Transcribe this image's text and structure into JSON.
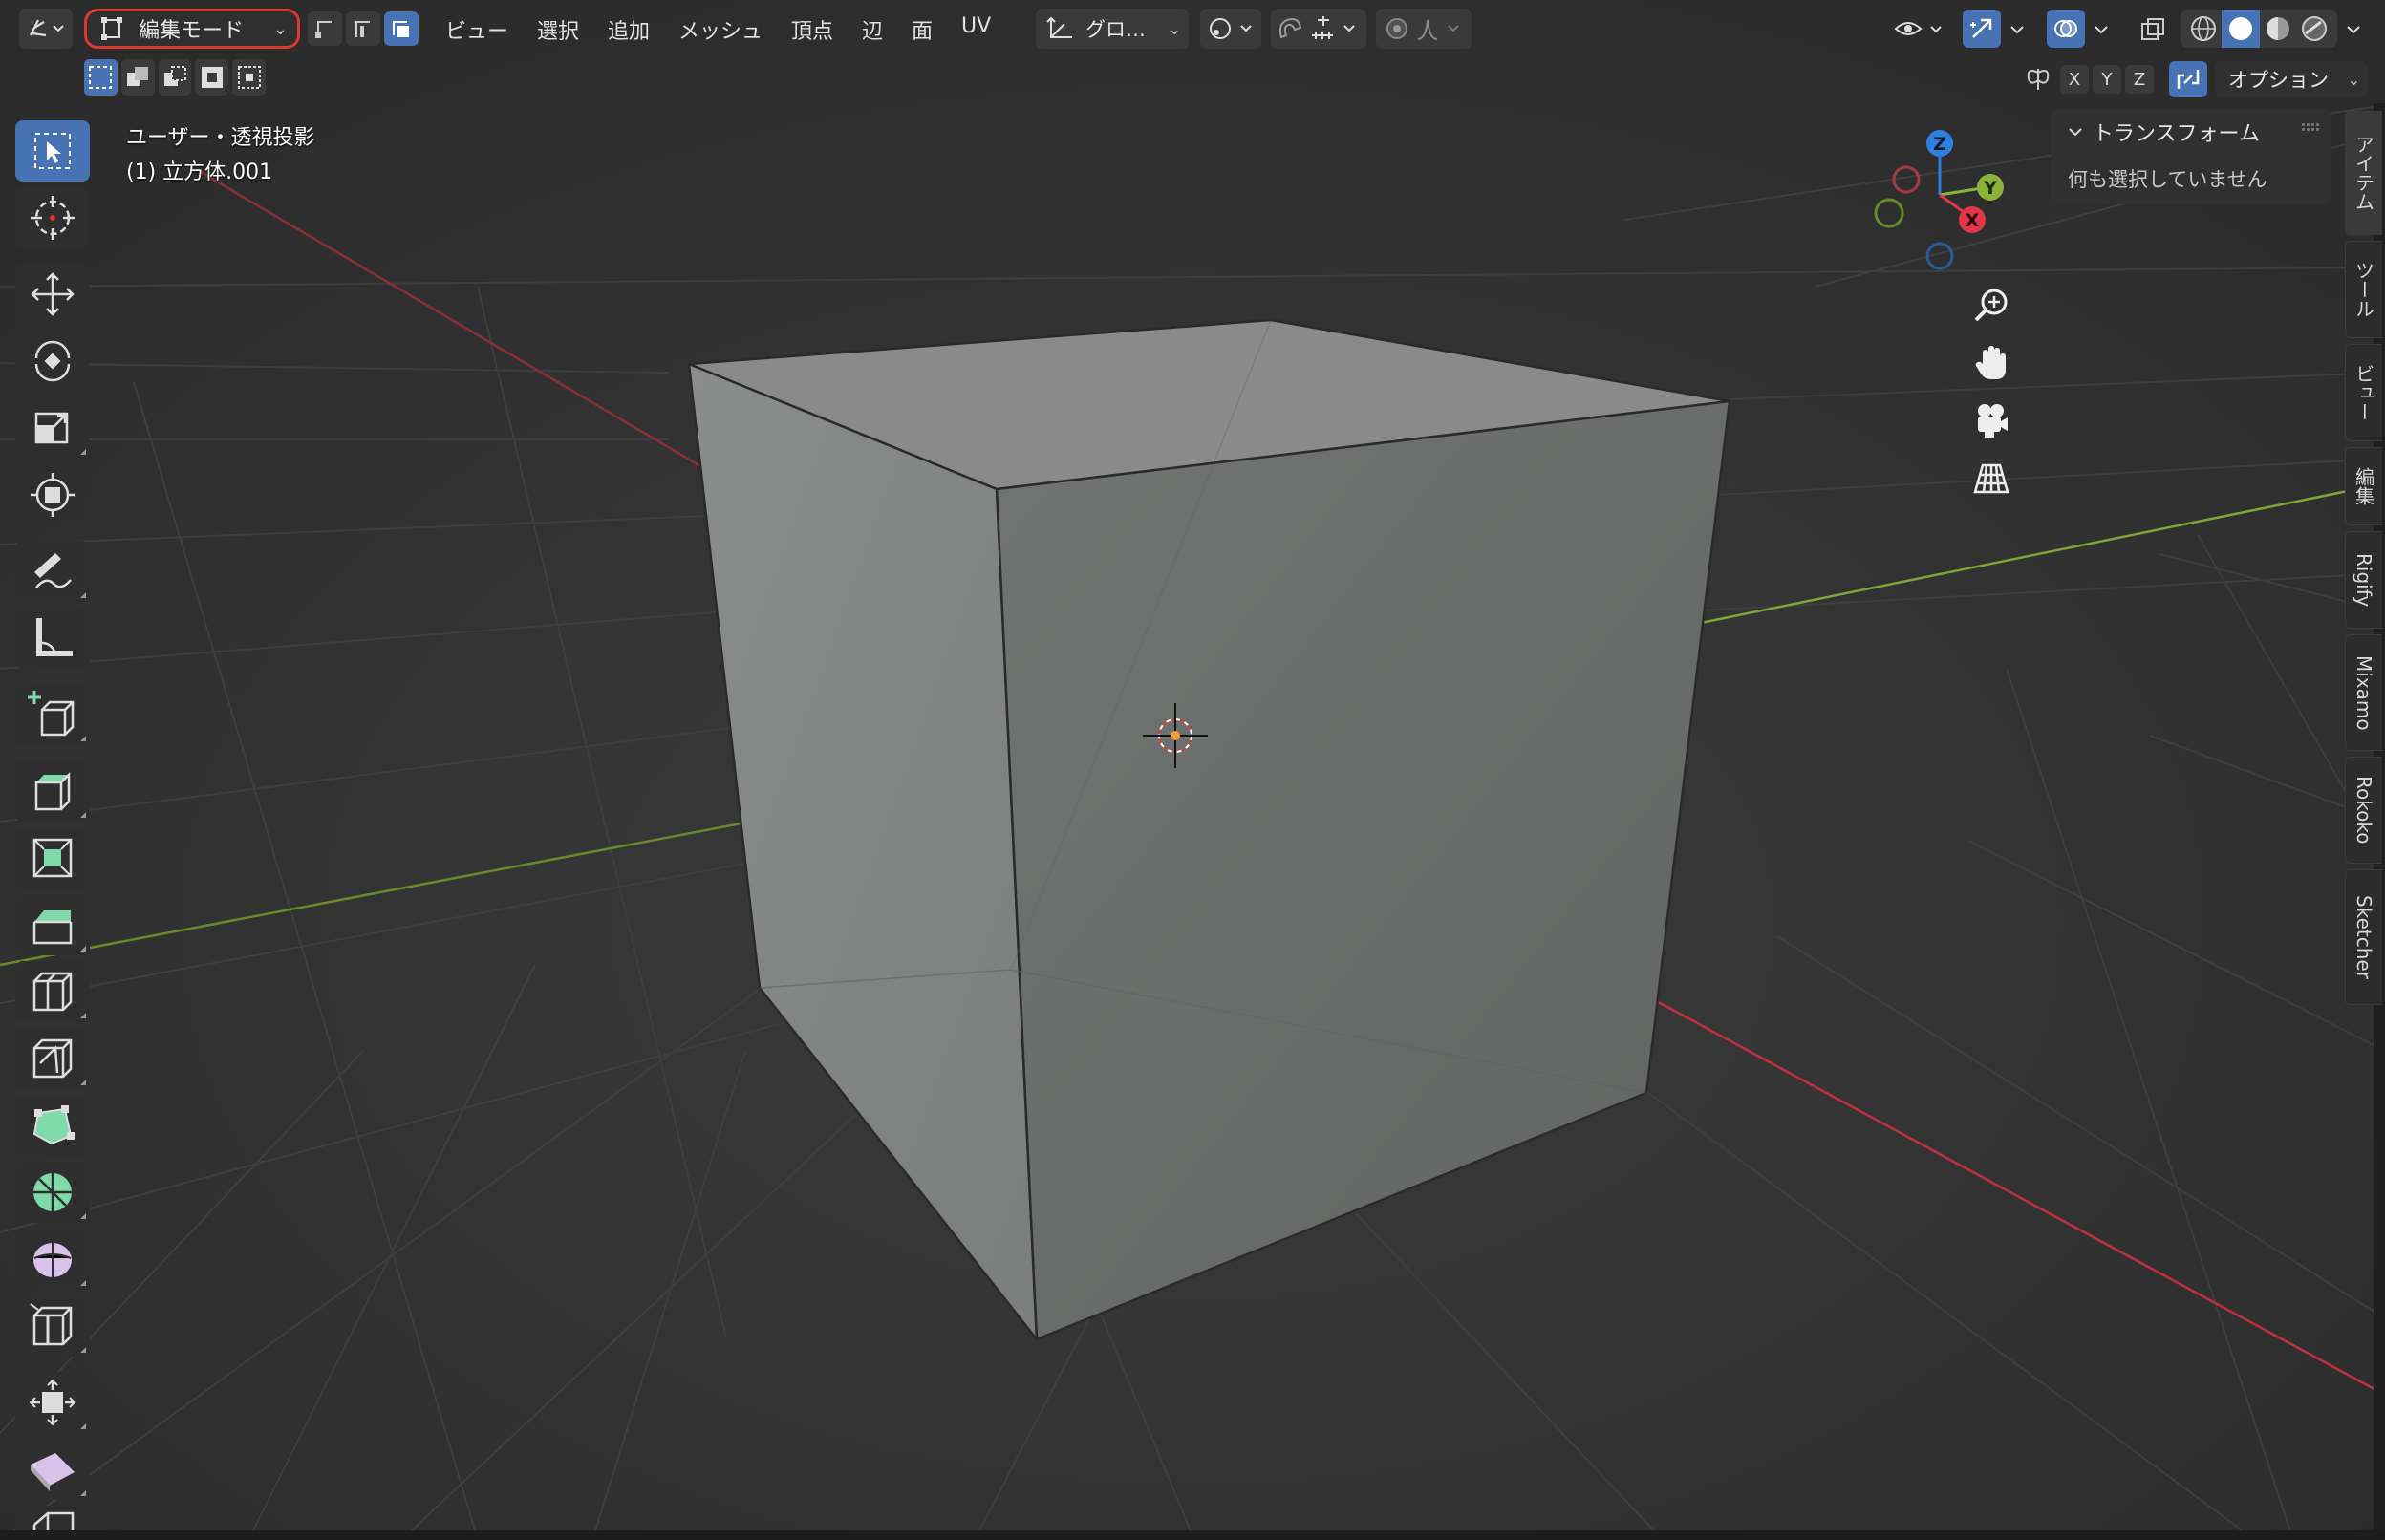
{
  "header": {
    "mode": "編集モード",
    "menus": [
      "ビュー",
      "選択",
      "追加",
      "メッシュ",
      "頂点",
      "辺",
      "面",
      "UV"
    ],
    "orientation": "グロ…"
  },
  "row2": {
    "axes": [
      "X",
      "Y",
      "Z"
    ],
    "options": "オプション"
  },
  "viewport": {
    "view_name": "ユーザー・透視投影",
    "object_name": "(1) 立方体.001"
  },
  "gizmo": {
    "z": "Z",
    "y": "Y",
    "x": "X"
  },
  "npanel": {
    "title": "トランスフォーム",
    "message": "何も選択していません"
  },
  "sidetabs": [
    "アイテム",
    "ツール",
    "ビュー",
    "編集",
    "Rigify",
    "Mixamo",
    "Rokoko",
    "Sketcher"
  ],
  "colors": {
    "active": "#4772b3",
    "x_axis": "#e2374a",
    "y_axis": "#8bb33a",
    "z_axis": "#2d7fe0",
    "mode_highlight": "#d83a32"
  },
  "icons": {
    "toolbar": [
      "select-box-icon",
      "cursor-icon",
      "move-icon",
      "rotate-icon",
      "scale-icon",
      "transform-icon",
      "annotate-icon",
      "measure-icon",
      "add-cube-icon",
      "extrude-icon",
      "inset-icon",
      "bevel-icon",
      "loop-cut-icon",
      "knife-icon",
      "poly-build-icon",
      "spin-icon",
      "smooth-icon",
      "edge-slide-icon",
      "shrink-fatten-icon",
      "shear-icon",
      "rip-icon"
    ]
  }
}
